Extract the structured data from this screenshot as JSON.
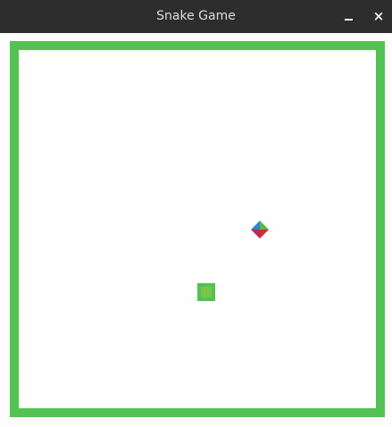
{
  "window": {
    "title": "Snake Game",
    "minimize_icon": "minimize-icon",
    "close_icon": "close-icon"
  },
  "game": {
    "border_color": "#53c253",
    "background_color": "#fdfefd",
    "snake": {
      "head_color": "#53c253",
      "inner_color": "#7bc549"
    },
    "food": {
      "colors": [
        "#3a7fd6",
        "#5aba3c",
        "#b02f4f",
        "#d22a3a"
      ]
    }
  }
}
